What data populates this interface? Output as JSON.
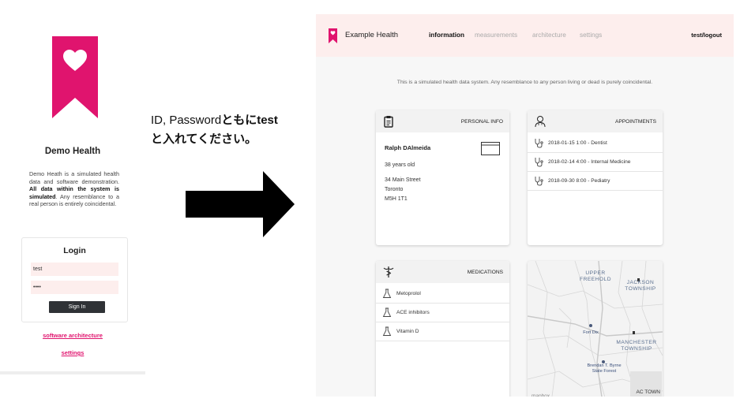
{
  "login_panel": {
    "brand_title": "Demo Health",
    "description_plain1": "Demo Heath is a simulated health data and software demonstration. ",
    "description_bold": "All data within the system is simulated",
    "description_plain2": ". Any resemblance to a real person is entirely coincidental.",
    "login_title": "Login",
    "username_value": "test",
    "password_value": "••••",
    "signin_label": "Sign In",
    "link_architecture": "software architecture",
    "link_settings": "settings"
  },
  "note": {
    "line1": "ID, Password",
    "line1b": "ともにtest",
    "line2": "と入れてください。"
  },
  "dashboard": {
    "app_name": "Example Health",
    "nav": [
      "information",
      "measurements",
      "architecture",
      "settings"
    ],
    "active_nav": "information",
    "logout": "test/logout",
    "disclaimer": "This is a simulated health data system. Any resemblance to any person living or dead is purely coincidental.",
    "personal": {
      "title": "PERSONAL INFO",
      "name": "Ralph DAlmeida",
      "age": "38 years old",
      "address": [
        "34 Main Street",
        "Toronto",
        "M5H 1T1"
      ]
    },
    "appointments": {
      "title": "APPOINTMENTS",
      "items": [
        "2018-01-15 1:00 - Dentist",
        "2018-02-14 4:00 - Internal Medicine",
        "2018-09-30 8:00 - Pediatry"
      ]
    },
    "medications": {
      "title": "MEDICATIONS",
      "items": [
        "Metoprolol",
        "ACE inhibitors",
        "Vitamin D"
      ]
    },
    "map": {
      "labels": [
        "UPPER FREEHOLD",
        "JACKSON TOWNSHIP",
        "Fort Dix",
        "MANCHESTER TOWNSHIP",
        "Brendan T. Byrne State Forest"
      ],
      "attribution": "mapbox",
      "corner_text": "AC TOWN"
    }
  },
  "colors": {
    "brand_pink": "#e0146e",
    "topbar_bg": "#fdeeed",
    "button_dark": "#2f3236"
  }
}
